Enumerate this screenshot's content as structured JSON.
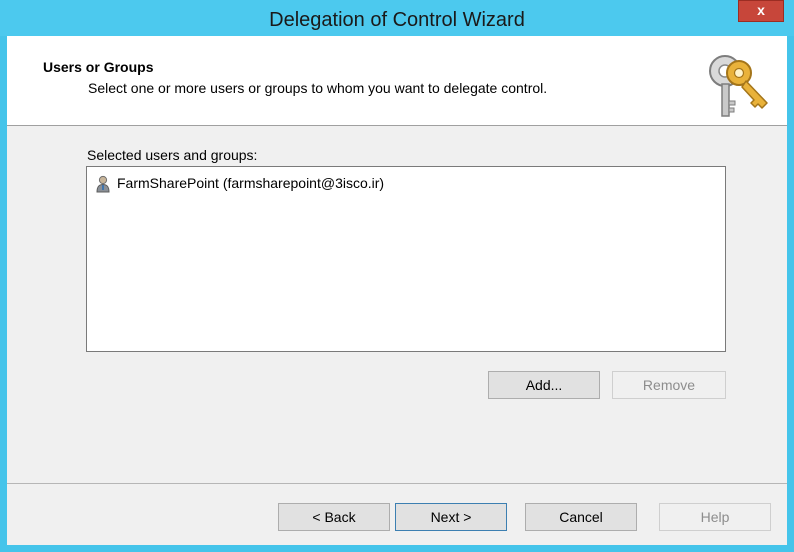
{
  "window": {
    "title": "Delegation of Control Wizard",
    "close_glyph": "x"
  },
  "header": {
    "title": "Users or Groups",
    "subtitle": "Select one or more users or groups to whom you want to delegate control.",
    "icon": "keys-icon"
  },
  "selection": {
    "label": "Selected users and groups:",
    "items": [
      {
        "icon": "user-icon",
        "text": "FarmSharePoint (farmsharepoint@3isco.ir)"
      }
    ],
    "add_label": "Add...",
    "remove_label": "Remove"
  },
  "footer": {
    "back_label": "< Back",
    "next_label": "Next >",
    "cancel_label": "Cancel",
    "help_label": "Help"
  },
  "colors": {
    "title_bar": "#4cc9ee",
    "close_button": "#c7463a",
    "dialog_bg": "#f0f0f0"
  }
}
